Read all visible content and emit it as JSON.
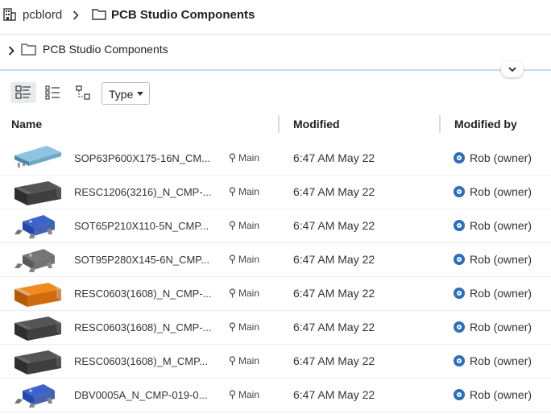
{
  "breadcrumb": {
    "workspace": "pcblord",
    "separator": "›",
    "current": "PCB Studio Components"
  },
  "folder_row": {
    "label": "PCB Studio Components"
  },
  "toolbar": {
    "type_filter": "Type"
  },
  "table": {
    "columns": [
      "Name",
      "Modified",
      "Modified by"
    ],
    "rows": [
      {
        "name": "SOP63P600X175-16N_CM...",
        "branch": "Main",
        "modified": "6:47 AM May 22",
        "modified_by": "Rob (owner)",
        "thumb": "chip-ic-light-blue"
      },
      {
        "name": "RESC1206(3216)_N_CMP-...",
        "branch": "Main",
        "modified": "6:47 AM May 22",
        "modified_by": "Rob (owner)",
        "thumb": "resistor-dark-gray"
      },
      {
        "name": "SOT65P210X110-5N_CMP...",
        "branch": "Main",
        "modified": "6:47 AM May 22",
        "modified_by": "Rob (owner)",
        "thumb": "sot-blue"
      },
      {
        "name": "SOT95P280X145-6N_CMP...",
        "branch": "Main",
        "modified": "6:47 AM May 22",
        "modified_by": "Rob (owner)",
        "thumb": "sot-gray"
      },
      {
        "name": "RESC0603(1608)_N_CMP-...",
        "branch": "Main",
        "modified": "6:47 AM May 22",
        "modified_by": "Rob (owner)",
        "thumb": "resistor-orange"
      },
      {
        "name": "RESC0603(1608)_N_CMP-...",
        "branch": "Main",
        "modified": "6:47 AM May 22",
        "modified_by": "Rob (owner)",
        "thumb": "resistor-dark-gray"
      },
      {
        "name": "RESC0603(1608)_M_CMP...",
        "branch": "Main",
        "modified": "6:47 AM May 22",
        "modified_by": "Rob (owner)",
        "thumb": "resistor-dark-gray"
      },
      {
        "name": "DBV0005A_N_CMP-019-0...",
        "branch": "Main",
        "modified": "6:47 AM May 22",
        "modified_by": "Rob (owner)",
        "thumb": "sot-blue"
      }
    ]
  },
  "colors": {
    "accent": "#2e6eb8",
    "blue_line": "#c7dcee"
  }
}
